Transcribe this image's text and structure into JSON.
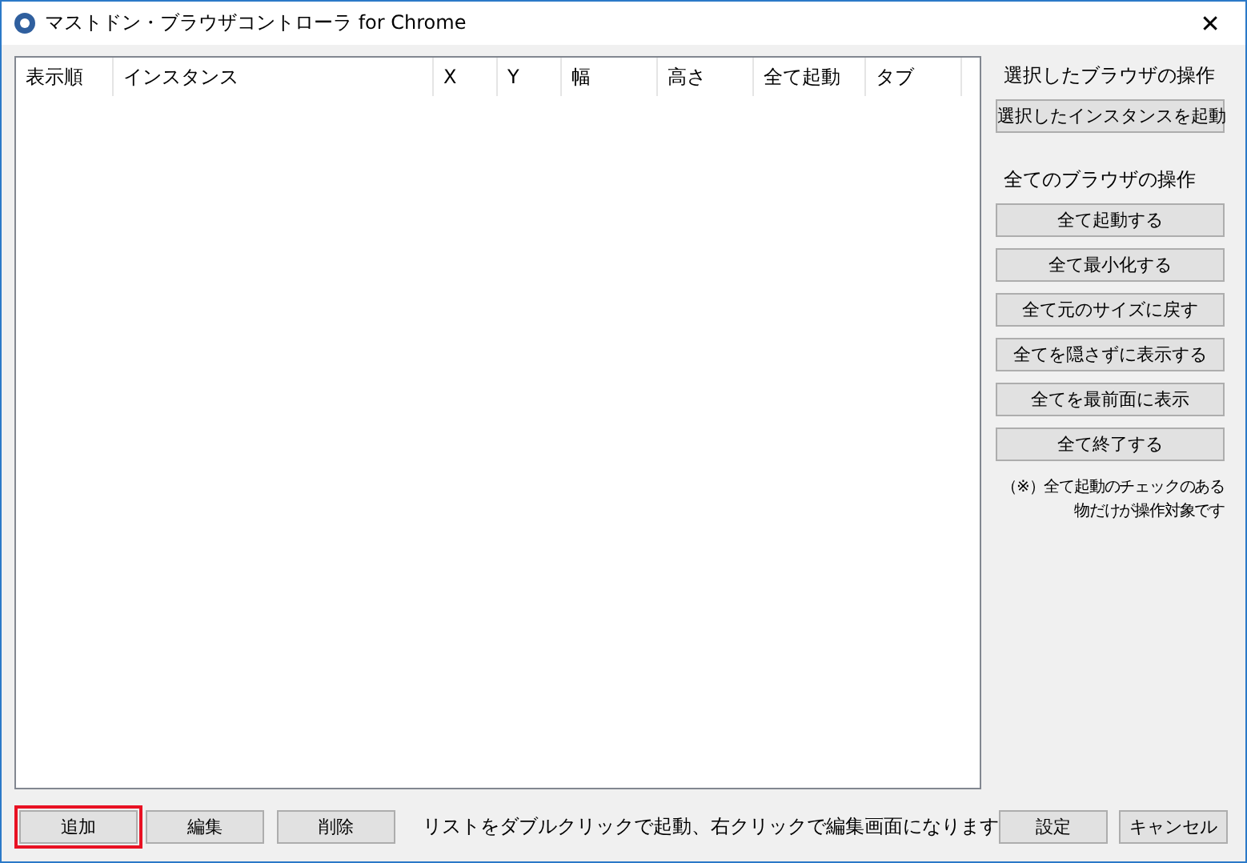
{
  "window": {
    "title": "マストドン・ブラウザコントローラ for Chrome",
    "close": "✕"
  },
  "table": {
    "columns": [
      "表示順",
      "インスタンス",
      "X",
      "Y",
      "幅",
      "高さ",
      "全て起動",
      "タブ"
    ]
  },
  "selected_panel": {
    "heading": "選択したブラウザの操作",
    "buttons": [
      "選択したインスタンスを起動"
    ]
  },
  "all_panel": {
    "heading": "全てのブラウザの操作",
    "buttons": [
      "全て起動する",
      "全て最小化する",
      "全て元のサイズに戻す",
      "全てを隠さずに表示する",
      "全てを最前面に表示",
      "全て終了する"
    ],
    "note": [
      "（※）全て起動のチェックのある",
      "物だけが操作対象です"
    ]
  },
  "bottom_buttons": [
    {
      "label": "追加",
      "highlighted": true
    },
    {
      "label": "編集",
      "highlighted": false
    },
    {
      "label": "削除",
      "highlighted": false
    }
  ],
  "hint": "リストをダブルクリックで起動、右クリックで編集画面になります",
  "dialog_buttons": [
    "設定",
    "キャンセル"
  ]
}
